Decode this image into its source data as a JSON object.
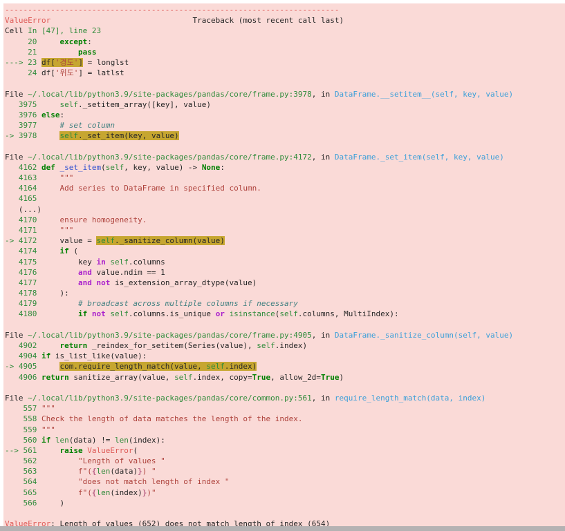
{
  "output": {
    "kind": "jupyter-error-traceback",
    "exception_type": "ValueError",
    "traceback_header": "Traceback (most recent call last)",
    "cell_reference": "Cell In [47], line 23",
    "final_line": "ValueError: Length of values (652) does not match length of index (654)",
    "values_length": 652,
    "index_length": 654
  },
  "palette": {
    "background": "#fadad7",
    "text": "#262626",
    "ansi_red": "#de5b57",
    "string_red": "#ae423c",
    "green": "#2f8b3a",
    "keyword_green": "#008000",
    "magenta": "#aa22cc",
    "blue": "#3050d0",
    "cyan": "#3c9fd8",
    "comment_teal": "#408080",
    "interpol_pink": "#bb6688",
    "highlight_bg": "#c6a630",
    "scrollbar": "#b5b2b3"
  },
  "frames": [
    {
      "file": "~/.local/lib/python3.9/site-packages/pandas/core/frame.py",
      "line": 3978,
      "function": "DataFrame.__setitem__(self, key, value)"
    },
    {
      "file": "~/.local/lib/python3.9/site-packages/pandas/core/frame.py",
      "line": 4172,
      "function": "DataFrame._set_item(self, key, value)"
    },
    {
      "file": "~/.local/lib/python3.9/site-packages/pandas/core/frame.py",
      "line": 4905,
      "function": "DataFrame._sanitize_column(self, value)"
    },
    {
      "file": "~/.local/lib/python3.9/site-packages/pandas/core/common.py",
      "line": 561,
      "function": "require_length_match(data, index)"
    }
  ],
  "traceback": {
    "lines": [
      [
        [
          "r",
          "-------------------------------------------------------------------------"
        ]
      ],
      [
        [
          "r",
          "ValueError"
        ],
        [
          "t",
          "                               Traceback (most recent call last)"
        ]
      ],
      [
        [
          "t",
          "Cell "
        ],
        [
          "g",
          "In [47], line 23"
        ]
      ],
      [
        [
          "g",
          "     20"
        ],
        [
          "t",
          "     "
        ],
        [
          "k",
          "except"
        ],
        [
          "t",
          ":"
        ]
      ],
      [
        [
          "g",
          "     21"
        ],
        [
          "t",
          "         "
        ],
        [
          "k",
          "pass"
        ]
      ],
      [
        [
          "g",
          "---> 23"
        ],
        [
          "t",
          " "
        ],
        [
          "hl",
          "df["
        ],
        [
          "hl s",
          "'경도'"
        ],
        [
          "hl",
          "]"
        ],
        [
          "t",
          " = longlst"
        ]
      ],
      [
        [
          "g",
          "     24"
        ],
        [
          "t",
          " df["
        ],
        [
          "s",
          "'위도'"
        ],
        [
          "t",
          "] = latlst"
        ]
      ],
      [
        [
          "t",
          " "
        ]
      ],
      [
        [
          "t",
          "File "
        ],
        [
          "g",
          "~/.local/lib/python3.9/site-packages/pandas/core/frame.py:3978"
        ],
        [
          "t",
          ", in "
        ],
        [
          "c",
          "DataFrame.__setitem__(self, key, value)"
        ]
      ],
      [
        [
          "g",
          "   3975"
        ],
        [
          "t",
          "     "
        ],
        [
          "g",
          "self"
        ],
        [
          "t",
          "._setitem_array([key], value)"
        ]
      ],
      [
        [
          "g",
          "   3976"
        ],
        [
          "t",
          " "
        ],
        [
          "k",
          "else"
        ],
        [
          "t",
          ":"
        ]
      ],
      [
        [
          "g",
          "   3977"
        ],
        [
          "t",
          "     "
        ],
        [
          "cm",
          "# set column"
        ]
      ],
      [
        [
          "g",
          "-> 3978"
        ],
        [
          "t",
          "     "
        ],
        [
          "hl g",
          "self"
        ],
        [
          "hl",
          "._set_item(key, value)"
        ]
      ],
      [
        [
          "t",
          " "
        ]
      ],
      [
        [
          "t",
          "File "
        ],
        [
          "g",
          "~/.local/lib/python3.9/site-packages/pandas/core/frame.py:4172"
        ],
        [
          "t",
          ", in "
        ],
        [
          "c",
          "DataFrame._set_item(self, key, value)"
        ]
      ],
      [
        [
          "g",
          "   4162"
        ],
        [
          "t",
          " "
        ],
        [
          "k",
          "def"
        ],
        [
          "t",
          " "
        ],
        [
          "b",
          "_set_item"
        ],
        [
          "t",
          "("
        ],
        [
          "g",
          "self"
        ],
        [
          "t",
          ", key, value) -> "
        ],
        [
          "k",
          "None"
        ],
        [
          "t",
          ":"
        ]
      ],
      [
        [
          "g",
          "   4163"
        ],
        [
          "t",
          "     "
        ],
        [
          "s",
          "\"\"\""
        ]
      ],
      [
        [
          "g",
          "   4164"
        ],
        [
          "t",
          "     "
        ],
        [
          "s",
          "Add series to DataFrame in specified column."
        ]
      ],
      [
        [
          "g",
          "   4165"
        ],
        [
          "t",
          " "
        ]
      ],
      [
        [
          "t",
          "   (...)"
        ]
      ],
      [
        [
          "g",
          "   4170"
        ],
        [
          "t",
          "     "
        ],
        [
          "s",
          "ensure homogeneity."
        ]
      ],
      [
        [
          "g",
          "   4171"
        ],
        [
          "t",
          "     "
        ],
        [
          "s",
          "\"\"\""
        ]
      ],
      [
        [
          "g",
          "-> 4172"
        ],
        [
          "t",
          "     value = "
        ],
        [
          "hl g",
          "self"
        ],
        [
          "hl",
          "._sanitize_column(value)"
        ]
      ],
      [
        [
          "g",
          "   4174"
        ],
        [
          "t",
          "     "
        ],
        [
          "k",
          "if"
        ],
        [
          "t",
          " ("
        ]
      ],
      [
        [
          "g",
          "   4175"
        ],
        [
          "t",
          "         key "
        ],
        [
          "m",
          "in"
        ],
        [
          "t",
          " "
        ],
        [
          "g",
          "self"
        ],
        [
          "t",
          ".columns"
        ]
      ],
      [
        [
          "g",
          "   4176"
        ],
        [
          "t",
          "         "
        ],
        [
          "m",
          "and"
        ],
        [
          "t",
          " value.ndim == 1"
        ]
      ],
      [
        [
          "g",
          "   4177"
        ],
        [
          "t",
          "         "
        ],
        [
          "m",
          "and"
        ],
        [
          "t",
          " "
        ],
        [
          "m",
          "not"
        ],
        [
          "t",
          " is_extension_array_dtype(value)"
        ]
      ],
      [
        [
          "g",
          "   4178"
        ],
        [
          "t",
          "     ):"
        ]
      ],
      [
        [
          "g",
          "   4179"
        ],
        [
          "t",
          "         "
        ],
        [
          "cm",
          "# broadcast across multiple columns if necessary"
        ]
      ],
      [
        [
          "g",
          "   4180"
        ],
        [
          "t",
          "         "
        ],
        [
          "k",
          "if"
        ],
        [
          "t",
          " "
        ],
        [
          "m",
          "not"
        ],
        [
          "t",
          " "
        ],
        [
          "g",
          "self"
        ],
        [
          "t",
          ".columns.is_unique "
        ],
        [
          "m",
          "or"
        ],
        [
          "t",
          " "
        ],
        [
          "g",
          "isinstance"
        ],
        [
          "t",
          "("
        ],
        [
          "g",
          "self"
        ],
        [
          "t",
          ".columns, MultiIndex):"
        ]
      ],
      [
        [
          "t",
          " "
        ]
      ],
      [
        [
          "t",
          "File "
        ],
        [
          "g",
          "~/.local/lib/python3.9/site-packages/pandas/core/frame.py:4905"
        ],
        [
          "t",
          ", in "
        ],
        [
          "c",
          "DataFrame._sanitize_column(self, value)"
        ]
      ],
      [
        [
          "g",
          "   4902"
        ],
        [
          "t",
          "     "
        ],
        [
          "k",
          "return"
        ],
        [
          "t",
          " _reindex_for_setitem(Series(value), "
        ],
        [
          "g",
          "self"
        ],
        [
          "t",
          ".index)"
        ]
      ],
      [
        [
          "g",
          "   4904"
        ],
        [
          "t",
          " "
        ],
        [
          "k",
          "if"
        ],
        [
          "t",
          " is_list_like(value):"
        ]
      ],
      [
        [
          "g",
          "-> 4905"
        ],
        [
          "t",
          "     "
        ],
        [
          "hl",
          "com.require_length_match(value, "
        ],
        [
          "hl g",
          "self"
        ],
        [
          "hl",
          ".index)"
        ]
      ],
      [
        [
          "g",
          "   4906"
        ],
        [
          "t",
          " "
        ],
        [
          "k",
          "return"
        ],
        [
          "t",
          " sanitize_array(value, "
        ],
        [
          "g",
          "self"
        ],
        [
          "t",
          ".index, copy="
        ],
        [
          "k",
          "True"
        ],
        [
          "t",
          ", allow_2d="
        ],
        [
          "k",
          "True"
        ],
        [
          "t",
          ")"
        ]
      ],
      [
        [
          "t",
          " "
        ]
      ],
      [
        [
          "t",
          "File "
        ],
        [
          "g",
          "~/.local/lib/python3.9/site-packages/pandas/core/common.py:561"
        ],
        [
          "t",
          ", in "
        ],
        [
          "c",
          "require_length_match(data, index)"
        ]
      ],
      [
        [
          "g",
          "    557"
        ],
        [
          "t",
          " "
        ],
        [
          "s",
          "\"\"\""
        ]
      ],
      [
        [
          "g",
          "    558"
        ],
        [
          "t",
          " "
        ],
        [
          "s",
          "Check the length of data matches the length of the index."
        ]
      ],
      [
        [
          "g",
          "    559"
        ],
        [
          "t",
          " "
        ],
        [
          "s",
          "\"\"\""
        ]
      ],
      [
        [
          "g",
          "    560"
        ],
        [
          "t",
          " "
        ],
        [
          "k",
          "if"
        ],
        [
          "t",
          " "
        ],
        [
          "g",
          "len"
        ],
        [
          "t",
          "(data) != "
        ],
        [
          "g",
          "len"
        ],
        [
          "t",
          "(index):"
        ]
      ],
      [
        [
          "g",
          "--> 561"
        ],
        [
          "t",
          "     "
        ],
        [
          "k",
          "raise"
        ],
        [
          "t",
          " "
        ],
        [
          "r",
          "ValueError"
        ],
        [
          "t",
          "("
        ]
      ],
      [
        [
          "g",
          "    562"
        ],
        [
          "t",
          "         "
        ],
        [
          "s",
          "\"Length of values \""
        ]
      ],
      [
        [
          "g",
          "    563"
        ],
        [
          "t",
          "         "
        ],
        [
          "s",
          "f\"("
        ],
        [
          "i",
          "{"
        ],
        [
          "g",
          "len"
        ],
        [
          "t",
          "(data)"
        ],
        [
          "i",
          "}"
        ],
        [
          "s",
          ") \""
        ]
      ],
      [
        [
          "g",
          "    564"
        ],
        [
          "t",
          "         "
        ],
        [
          "s",
          "\"does not match length of index \""
        ]
      ],
      [
        [
          "g",
          "    565"
        ],
        [
          "t",
          "         "
        ],
        [
          "s",
          "f\"("
        ],
        [
          "i",
          "{"
        ],
        [
          "g",
          "len"
        ],
        [
          "t",
          "(index)"
        ],
        [
          "i",
          "}"
        ],
        [
          "s",
          ")\""
        ]
      ],
      [
        [
          "g",
          "    566"
        ],
        [
          "t",
          "     )"
        ]
      ],
      [
        [
          "t",
          " "
        ]
      ],
      [
        [
          "r u",
          "ValueError"
        ],
        [
          "t",
          ": Length of values (652) does not match length of index (654)"
        ]
      ]
    ]
  }
}
